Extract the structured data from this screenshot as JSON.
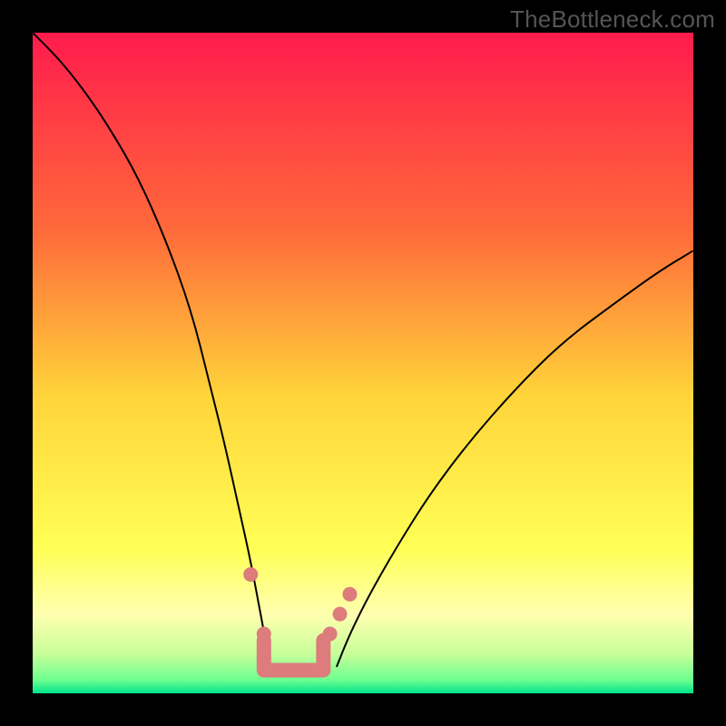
{
  "watermark": "TheBottleneck.com",
  "colors": {
    "accent_marker": "#dd7b7d",
    "curve": "#000000",
    "gradient_stops": [
      {
        "pos": 0,
        "color": "#ff1b4d"
      },
      {
        "pos": 0.3,
        "color": "#ff6a3a"
      },
      {
        "pos": 0.55,
        "color": "#ffd43a"
      },
      {
        "pos": 0.78,
        "color": "#ffff55"
      },
      {
        "pos": 0.88,
        "color": "#ffffb0"
      },
      {
        "pos": 0.94,
        "color": "#c8ff9a"
      },
      {
        "pos": 0.975,
        "color": "#6cff8f"
      },
      {
        "pos": 1.0,
        "color": "#00e38c"
      }
    ]
  },
  "chart_data": {
    "type": "line",
    "title": "",
    "xlabel": "",
    "ylabel": "",
    "xlim": [
      0,
      100
    ],
    "ylim": [
      0,
      100
    ],
    "grid": false,
    "legend": false,
    "series": [
      {
        "name": "left-curve",
        "x": [
          0,
          4,
          8,
          12,
          16,
          20,
          24,
          27,
          29,
          31,
          33,
          34.5,
          36
        ],
        "y_pct": [
          100,
          96,
          91,
          85,
          78,
          69,
          58,
          46,
          38,
          29,
          20,
          12,
          4
        ],
        "y_bottleneck_pct": [
          0,
          4,
          9,
          15,
          22,
          31,
          42,
          54,
          62,
          71,
          80,
          88,
          96
        ]
      },
      {
        "name": "right-curve",
        "x": [
          46,
          48,
          51,
          55,
          60,
          66,
          73,
          80,
          88,
          95,
          100
        ],
        "y_pct": [
          4,
          9,
          15,
          22,
          30,
          38,
          46,
          53,
          59,
          64,
          67
        ],
        "y_bottleneck_pct": [
          96,
          91,
          85,
          78,
          70,
          62,
          54,
          47,
          41,
          36,
          33
        ]
      }
    ],
    "optimum_markers": [
      {
        "x": 33.0,
        "y_pct": 18
      },
      {
        "x": 35.0,
        "y_pct": 9
      },
      {
        "x": 45.0,
        "y_pct": 9
      },
      {
        "x": 46.5,
        "y_pct": 12
      },
      {
        "x": 48.0,
        "y_pct": 15
      }
    ],
    "optimum_bracket": {
      "left": {
        "x": 35.0,
        "y_pct": 8
      },
      "right": {
        "x": 44.0,
        "y_pct": 8
      },
      "bottom_y_pct": 3.5
    },
    "notes": "y_pct is percent of chart height from bottom (visual). y_bottleneck_pct is the implied bottleneck value (100 - y_pct) consistent with the gradient where 0% = green bottom, 100% = red top."
  }
}
